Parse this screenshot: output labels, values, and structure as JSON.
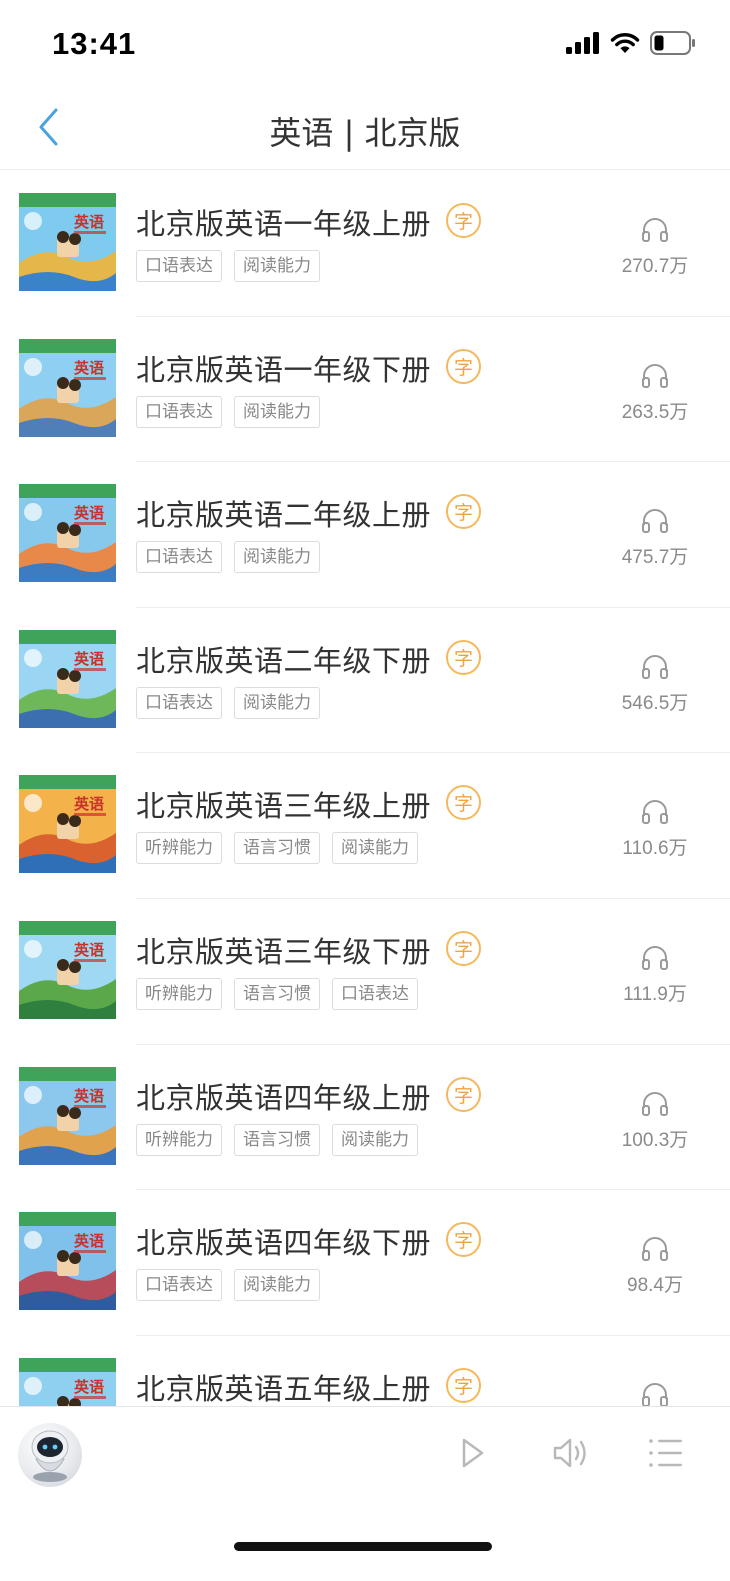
{
  "status_bar": {
    "time": "13:41"
  },
  "nav": {
    "title": "英语 | 北京版"
  },
  "badge_char": "字",
  "books": [
    {
      "title": "北京版英语一年级上册",
      "tags": [
        "口语表达",
        "阅读能力"
      ],
      "plays": "270.7万"
    },
    {
      "title": "北京版英语一年级下册",
      "tags": [
        "口语表达",
        "阅读能力"
      ],
      "plays": "263.5万"
    },
    {
      "title": "北京版英语二年级上册",
      "tags": [
        "口语表达",
        "阅读能力"
      ],
      "plays": "475.7万"
    },
    {
      "title": "北京版英语二年级下册",
      "tags": [
        "口语表达",
        "阅读能力"
      ],
      "plays": "546.5万"
    },
    {
      "title": "北京版英语三年级上册",
      "tags": [
        "听辨能力",
        "语言习惯",
        "阅读能力"
      ],
      "plays": "110.6万"
    },
    {
      "title": "北京版英语三年级下册",
      "tags": [
        "听辨能力",
        "语言习惯",
        "口语表达"
      ],
      "plays": "111.9万"
    },
    {
      "title": "北京版英语四年级上册",
      "tags": [
        "听辨能力",
        "语言习惯",
        "阅读能力"
      ],
      "plays": "100.3万"
    },
    {
      "title": "北京版英语四年级下册",
      "tags": [
        "口语表达",
        "阅读能力"
      ],
      "plays": "98.4万"
    },
    {
      "title": "北京版英语五年级上册",
      "tags": [],
      "plays": ""
    }
  ],
  "cover_text": "英语",
  "icons": {
    "back": "chevron-left-icon",
    "play_count": "headphone-icon",
    "player_play": "play-icon",
    "player_volume": "volume-icon",
    "player_playlist": "playlist-icon"
  },
  "colors": {
    "accent": "#4aa3df",
    "badge": "#f0a440",
    "tag_border": "#dcdcdc",
    "text_primary": "#333333",
    "text_secondary": "#8a8a8a"
  }
}
